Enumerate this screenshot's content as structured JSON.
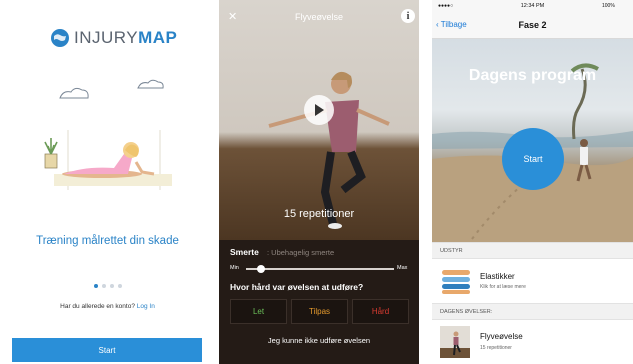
{
  "screen1": {
    "logo_prefix": "INJURY",
    "logo_suffix": "MAP",
    "title": "Træning målrettet din skade",
    "pager_pages": 4,
    "pager_active": 1,
    "login_prompt": "Har du allerede en konto?",
    "login_link": "Log In",
    "start_label": "Start",
    "accent": "#2a83c7"
  },
  "screen2": {
    "title": "Flyveøvelse",
    "close_icon": "close-icon",
    "info_label": "i",
    "repetitions": "15 repetitioner",
    "pain_label": "Smerte",
    "pain_description": ": Ubehagelig smerte",
    "slider_min": "Min",
    "slider_max": "Max",
    "slider_value": 0.1,
    "question": "Hvor hård var øvelsen at udføre?",
    "options": [
      "Let",
      "Tilpas",
      "Hård"
    ],
    "option_colors": [
      "#6bbf59",
      "#e59a2d",
      "#d83b31"
    ],
    "cannot_perform": "Jeg kunne ikke udføre øvelsen"
  },
  "screen3": {
    "status_left": "●●●●○",
    "time": "12:34 PM",
    "battery": "100%",
    "back_label": "Tilbage",
    "nav_title": "Fase 2",
    "hero_title": "Dagens program",
    "start_label": "Start",
    "equipment_header": "UDSTYR",
    "equipment_title": "Elastikker",
    "equipment_sub": "Klik for at læse mere",
    "exercises_header": "DAGENS ØVELSER:",
    "exercise_title": "Flyveøvelse",
    "exercise_sub": "15 repetitioner"
  }
}
